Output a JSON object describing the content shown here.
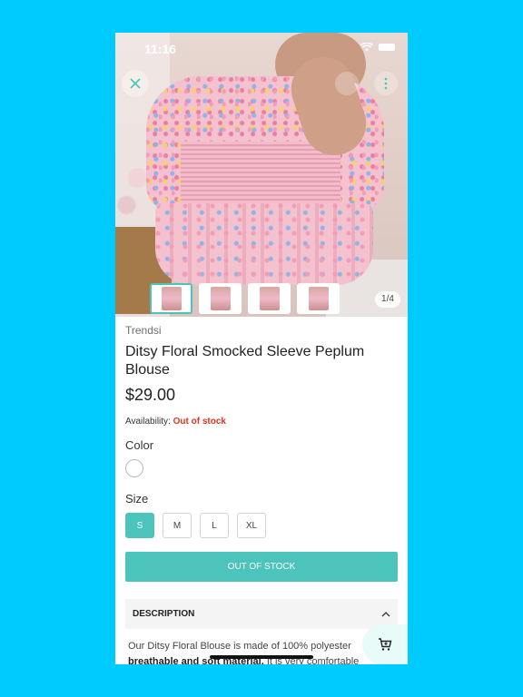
{
  "status_bar": {
    "time": "11:16"
  },
  "gallery": {
    "counter": "1/4",
    "thumbnail_count": 4
  },
  "product": {
    "brand": "Trendsi",
    "title": "Ditsy Floral Smocked Sleeve Peplum Blouse",
    "price": "$29.00",
    "availability_label": "Availability:",
    "availability_value": "Out of stock",
    "color_label": "Color",
    "size_label": "Size",
    "sizes": [
      "S",
      "M",
      "L",
      "XL"
    ],
    "selected_size": "S",
    "button_label": "OUT OF STOCK"
  },
  "description": {
    "title": "DESCRIPTION",
    "line1": "Our Ditsy Floral Blouse is made of 100% polyester",
    "line2_bold": "breathable and soft material.",
    "line2_rest": " It is very comfortable"
  },
  "colors": {
    "accent": "#4cc3bb",
    "out_of_stock": "#e1341e",
    "background": "#00cbff"
  }
}
